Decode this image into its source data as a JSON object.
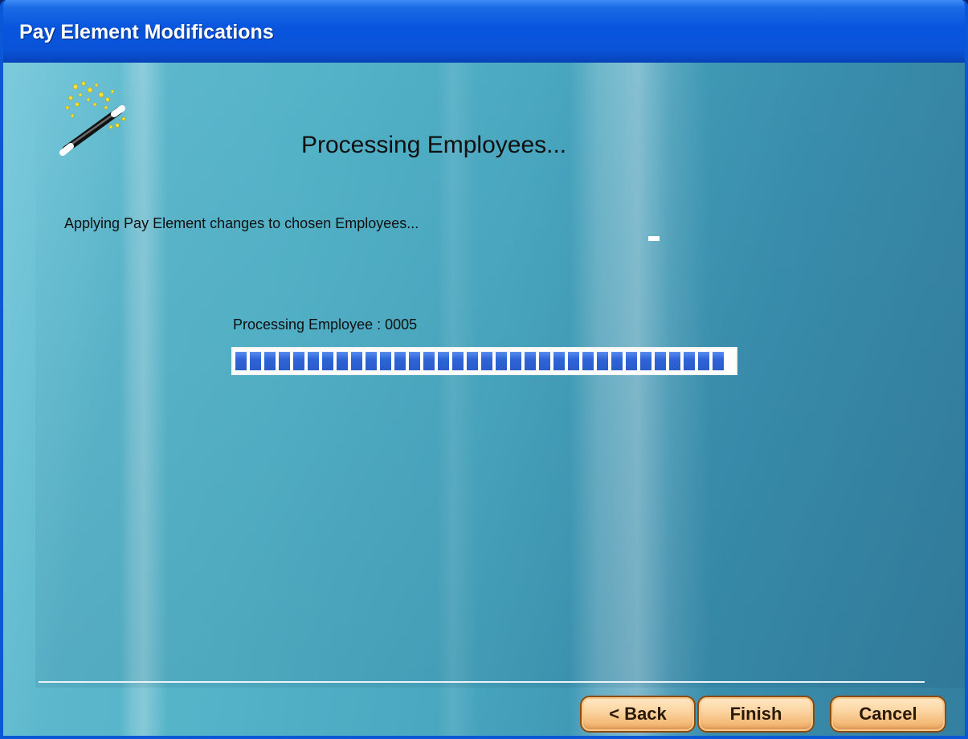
{
  "window": {
    "title": "Pay Element Modifications"
  },
  "header": {
    "icon": "magic-wand-icon",
    "heading": "Processing Employees..."
  },
  "main": {
    "subtitle": "Applying Pay Element changes to chosen Employees...",
    "status_label": "Processing Employee : 0005",
    "progress_fraction": 1.0
  },
  "buttons": {
    "back_label": "< Back",
    "finish_label": "Finish",
    "cancel_label": "Cancel"
  },
  "colors": {
    "titlebar": "#0855dd",
    "progress_chunk": "#2f64d8",
    "button_fill": "#f5bc7a",
    "client_bg": "#4aa8c0"
  }
}
